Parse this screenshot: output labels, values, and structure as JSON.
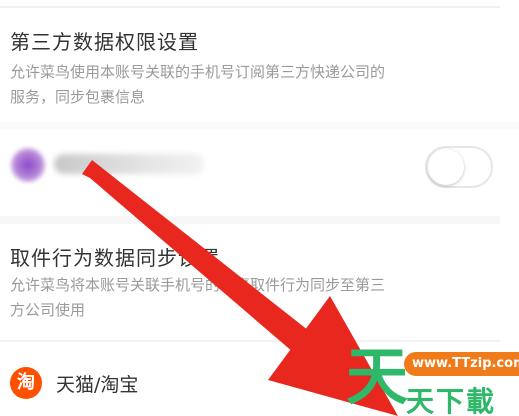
{
  "sections": {
    "third_party": {
      "title": "第三方数据权限设置",
      "description": "允许菜鸟使用本账号关联的手机号订阅第三方快递公司的服务，同步包裹信息"
    },
    "pickup": {
      "title": "取件行为数据同步设置",
      "description": "允许菜鸟将本账号关联手机号的包裹取件行为同步至第三方公司使用"
    }
  },
  "blurred_row": {
    "toggle_state": "off"
  },
  "app_row": {
    "icon_char": "淘",
    "label": "天猫/淘宝"
  },
  "watermark": {
    "big_char": "天",
    "url": "www.TTzip.com",
    "name": "天下載"
  },
  "colors": {
    "annotation_arrow": "#e8281f",
    "tmall_orange": "#ff5000",
    "watermark_green": "#2fb86a",
    "watermark_orange": "#f07b1a"
  }
}
